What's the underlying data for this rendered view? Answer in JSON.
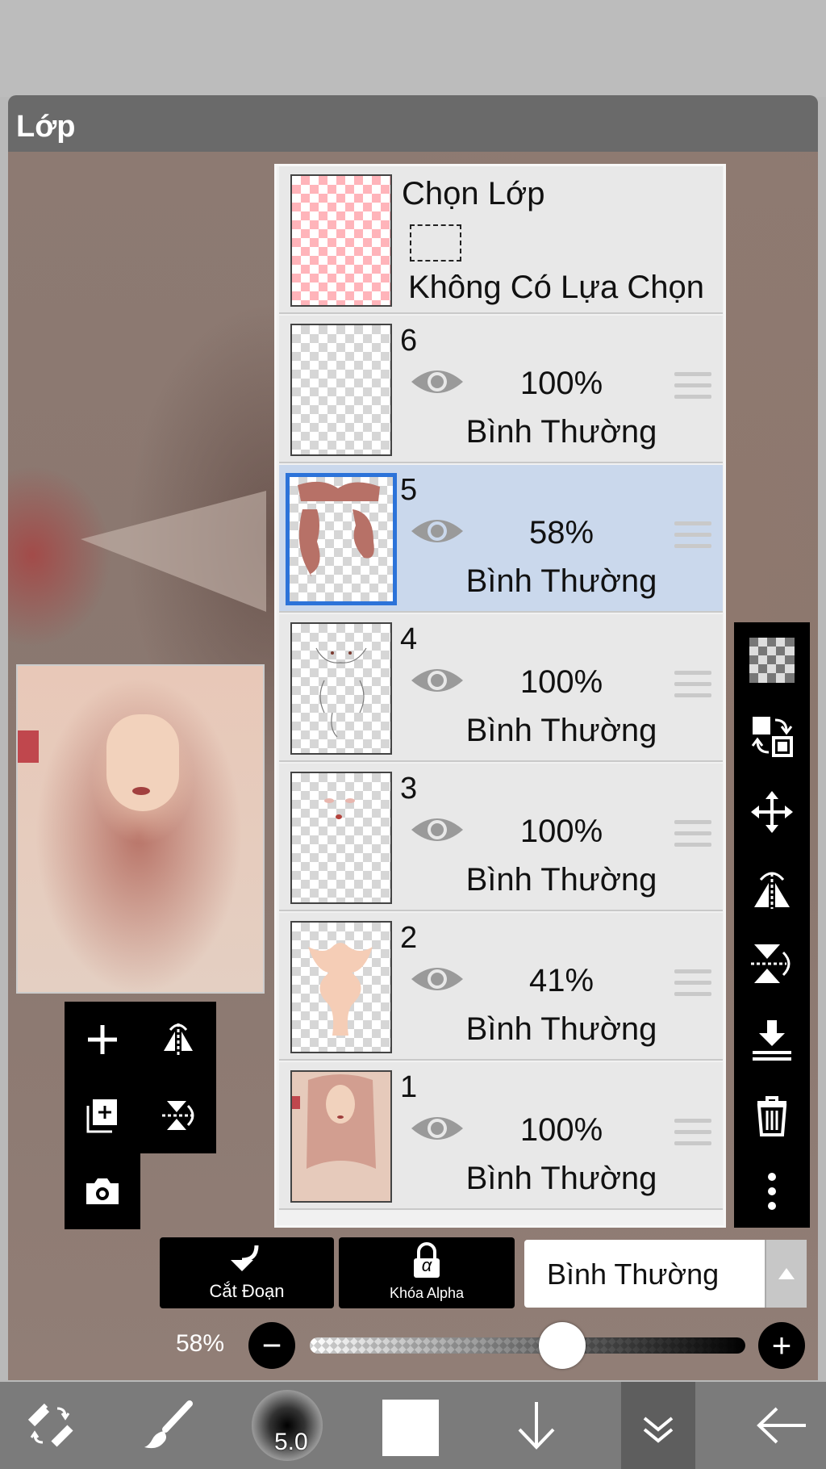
{
  "panel": {
    "title": "Lớp"
  },
  "selection_layer": {
    "title": "Chọn Lớp",
    "subtitle": "Không Có Lựa Chọn"
  },
  "layers": [
    {
      "number": "6",
      "opacity": "100%",
      "blend": "Bình Thường",
      "selected": false,
      "visible": true
    },
    {
      "number": "5",
      "opacity": "58%",
      "blend": "Bình Thường",
      "selected": true,
      "visible": true
    },
    {
      "number": "4",
      "opacity": "100%",
      "blend": "Bình Thường",
      "selected": false,
      "visible": true
    },
    {
      "number": "3",
      "opacity": "100%",
      "blend": "Bình Thường",
      "selected": false,
      "visible": true
    },
    {
      "number": "2",
      "opacity": "41%",
      "blend": "Bình Thường",
      "selected": false,
      "visible": true
    },
    {
      "number": "1",
      "opacity": "100%",
      "blend": "Bình Thường",
      "selected": false,
      "visible": true
    }
  ],
  "controls": {
    "clip_label": "Cắt Đoạn",
    "alpha_lock_label": "Khóa Alpha",
    "alpha_glyph": "α",
    "blend_mode": "Bình Thường",
    "opacity_label": "58%",
    "opacity_value": 0.58,
    "minus": "−",
    "plus": "+"
  },
  "bottom_bar": {
    "brush_size": "5.0",
    "current_color": "#ffffff"
  },
  "colors": {
    "selected_row": "#cad8ec",
    "selection_border": "#2c73d9",
    "panel_header": "#6a6a6a"
  }
}
